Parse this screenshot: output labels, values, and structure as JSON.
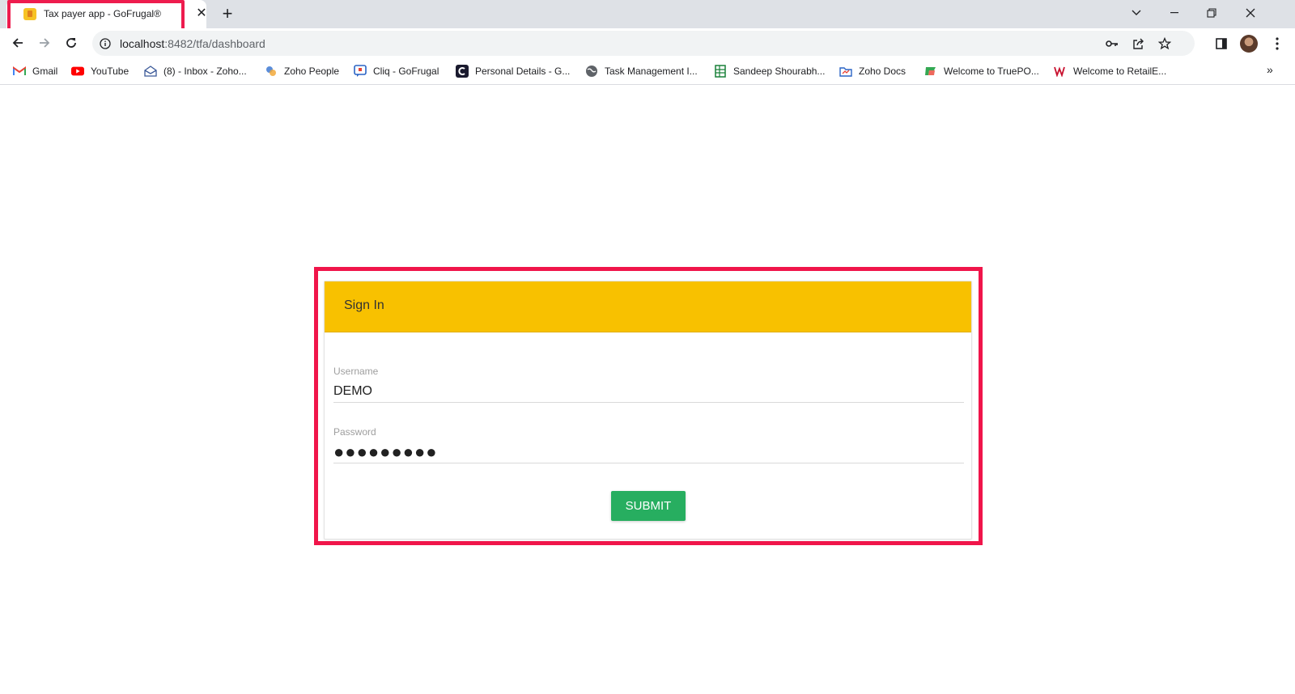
{
  "browser": {
    "tab": {
      "title": "Tax payer app - GoFrugal®",
      "favicon": "gofrugal-favicon-icon"
    },
    "new_tab_icon": "plus-icon",
    "window_controls": [
      "tab-search-icon",
      "minimize-icon",
      "restore-icon",
      "close-icon"
    ],
    "address": {
      "host": "localhost",
      "rest": ":8482/tfa/dashboard"
    },
    "omnibox_icons": [
      "info-icon",
      "key-icon",
      "share-icon",
      "star-icon"
    ],
    "toolbar_icons": [
      "side-panel-icon",
      "profile-avatar",
      "kebab-menu-icon"
    ]
  },
  "bookmarks": [
    {
      "label": "Gmail",
      "icon": "gmail-icon"
    },
    {
      "label": "YouTube",
      "icon": "youtube-icon"
    },
    {
      "label": "(8) - Inbox - Zoho...",
      "icon": "mail-icon"
    },
    {
      "label": "Zoho People",
      "icon": "zoho-people-icon"
    },
    {
      "label": "Cliq - GoFrugal",
      "icon": "cliq-icon"
    },
    {
      "label": "Personal Details - G...",
      "icon": "personal-details-icon"
    },
    {
      "label": "Task Management I...",
      "icon": "globe-icon"
    },
    {
      "label": "Sandeep Shourabh...",
      "icon": "sheet-icon"
    },
    {
      "label": "Zoho Docs",
      "icon": "zoho-docs-icon"
    },
    {
      "label": "Welcome to TruePO...",
      "icon": "truepos-icon"
    },
    {
      "label": "Welcome to RetailE...",
      "icon": "retaile-icon"
    }
  ],
  "bookmarks_more": "»",
  "signin": {
    "title": "Sign In",
    "username_label": "Username",
    "username_value": "DEMO",
    "password_label": "Password",
    "password_value": "●●●●●●●●●",
    "submit_label": "SUBMIT"
  },
  "colors": {
    "header": "#f8c100",
    "submit": "#27ae60",
    "highlight": "#f0154a"
  }
}
